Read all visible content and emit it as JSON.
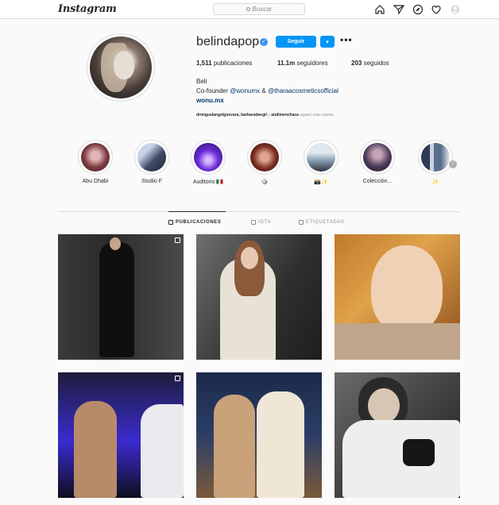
{
  "app": {
    "logo": "Instagram"
  },
  "search": {
    "placeholder": "Buscar"
  },
  "nav": {
    "icons": [
      "home-icon",
      "direct-icon",
      "explore-icon",
      "activity-icon",
      "profile-icon"
    ]
  },
  "profile": {
    "username": "belindapop",
    "follow_label": "Seguir",
    "dropdown_label": "▾",
    "more_label": "•••",
    "stats": {
      "posts_count": "1,511",
      "posts_label": "publicaciones",
      "followers_count": "11.1m",
      "followers_label": "seguidores",
      "following_count": "203",
      "following_label": "seguidos"
    },
    "full_name": "Beli",
    "bio_prefix": "Co-founder ",
    "bio_mention_1": "@wonumx",
    "bio_and": " & ",
    "bio_mention_2": "@tharaacosmeticsofficial",
    "link": "wonu.mx",
    "followed_by_names": "drmiguelangelguevara, barbaradeegil",
    "followed_by_and": " y ",
    "followed_by_last": "andimenchaca",
    "followed_by_suffix": " siguen esta cuenta"
  },
  "highlights": [
    {
      "label": "Abu Dhabi",
      "color": "#7a3a3e"
    },
    {
      "label": "Studio F",
      "color": "#3f4a66"
    },
    {
      "label": "Auditorio 🇲🇽",
      "color": "#6a2bd9"
    },
    {
      "label": "🎲",
      "color": "#7b2e22"
    },
    {
      "label": "📸✨",
      "color": "#8da2b6"
    },
    {
      "label": "Colección...",
      "color": "#4b3a5a"
    },
    {
      "label": "✨",
      "color": "#5a6f8c"
    }
  ],
  "tabs": [
    {
      "label": "PUBLICACIONES",
      "icon": "grid-icon",
      "active": true
    },
    {
      "label": "IGTV",
      "icon": "igtv-icon",
      "active": false
    },
    {
      "label": "ETIQUETADAS",
      "icon": "tagged-icon",
      "active": false
    }
  ],
  "posts": [
    {
      "name": "post-1",
      "multi": true
    },
    {
      "name": "post-2",
      "multi": false
    },
    {
      "name": "post-3",
      "multi": false
    },
    {
      "name": "post-4",
      "multi": true
    },
    {
      "name": "post-5",
      "multi": false
    },
    {
      "name": "post-6",
      "multi": false
    }
  ],
  "colors": {
    "accent": "#0095f6",
    "text": "#262626",
    "muted": "#8e8e8e",
    "border": "#dbdbdb",
    "link": "#00376b"
  }
}
